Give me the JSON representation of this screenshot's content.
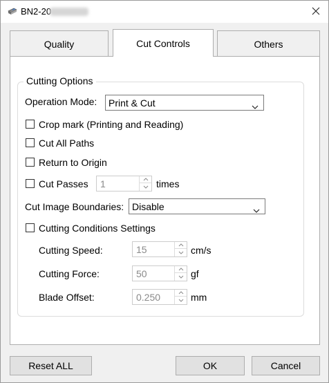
{
  "window": {
    "title": "BN2-20",
    "close_icon": "close-icon"
  },
  "tabs": [
    {
      "label": "Quality",
      "active": false
    },
    {
      "label": "Cut Controls",
      "active": true
    },
    {
      "label": "Others",
      "active": false
    }
  ],
  "cutting_options": {
    "group_title": "Cutting Options",
    "operation_mode": {
      "label": "Operation Mode:",
      "value": "Print & Cut"
    },
    "crop_mark": {
      "label": "Crop mark (Printing and Reading)",
      "checked": false
    },
    "cut_all_paths": {
      "label": "Cut All Paths",
      "checked": false
    },
    "return_to_origin": {
      "label": "Return to Origin",
      "checked": false
    },
    "cut_passes": {
      "label": "Cut Passes",
      "checked": false,
      "value": "1",
      "unit": "times"
    },
    "cut_image_boundaries": {
      "label": "Cut Image Boundaries:",
      "value": "Disable"
    },
    "cutting_conditions": {
      "label": "Cutting Conditions Settings",
      "checked": false
    },
    "cutting_speed": {
      "label": "Cutting Speed:",
      "value": "15",
      "unit": "cm/s"
    },
    "cutting_force": {
      "label": "Cutting Force:",
      "value": "50",
      "unit": "gf"
    },
    "blade_offset": {
      "label": "Blade Offset:",
      "value": "0.250",
      "unit": "mm"
    }
  },
  "footer": {
    "reset_label": "Reset ALL",
    "ok_label": "OK",
    "cancel_label": "Cancel"
  }
}
